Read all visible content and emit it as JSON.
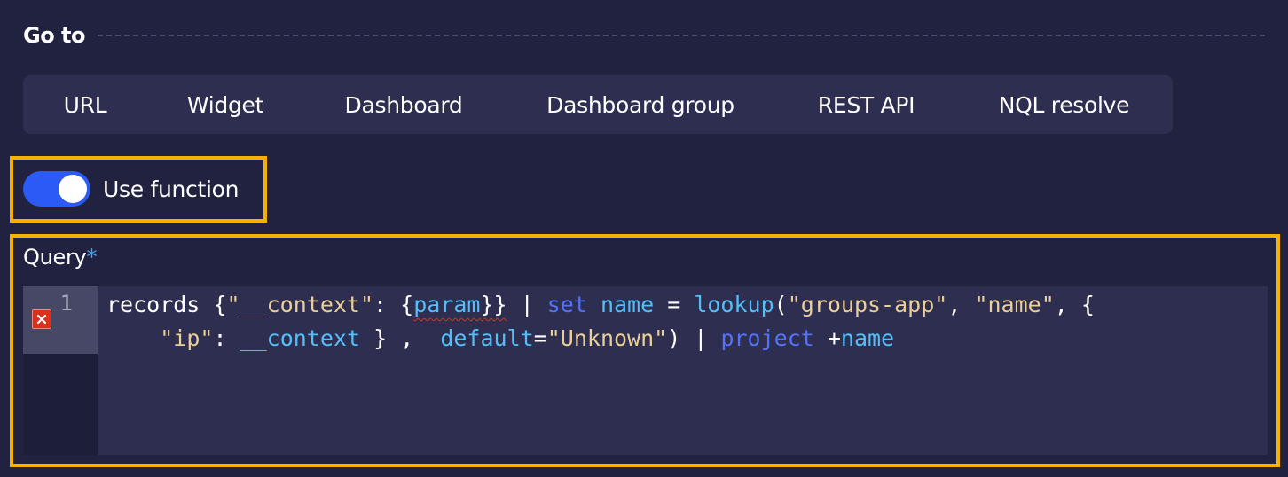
{
  "section": {
    "title": "Go to"
  },
  "tabs": [
    {
      "label": "URL",
      "active": false
    },
    {
      "label": "Widget",
      "active": false
    },
    {
      "label": "Dashboard",
      "active": false
    },
    {
      "label": "Dashboard group",
      "active": false
    },
    {
      "label": "REST API",
      "active": false
    },
    {
      "label": "NQL resolve",
      "active": true
    }
  ],
  "toggle": {
    "label": "Use function",
    "checked": true
  },
  "query": {
    "label": "Query",
    "required_marker": "*",
    "line_number": "1",
    "has_error": true,
    "code_lines": [
      [
        {
          "t": "records {",
          "c": "default"
        },
        {
          "t": "\"__context\"",
          "c": "string"
        },
        {
          "t": ": {",
          "c": "default"
        },
        {
          "t": "param",
          "c": "var",
          "err": true
        },
        {
          "t": "}}",
          "c": "default",
          "err": true
        },
        {
          "t": " | ",
          "c": "default"
        },
        {
          "t": "set",
          "c": "keyword"
        },
        {
          "t": " ",
          "c": "default"
        },
        {
          "t": "name",
          "c": "var"
        },
        {
          "t": " = ",
          "c": "default"
        },
        {
          "t": "lookup",
          "c": "var"
        },
        {
          "t": "(",
          "c": "default"
        },
        {
          "t": "\"groups-app\"",
          "c": "string"
        },
        {
          "t": ", ",
          "c": "default"
        },
        {
          "t": "\"name\"",
          "c": "string"
        },
        {
          "t": ", {",
          "c": "default"
        }
      ],
      [
        {
          "t": "    ",
          "c": "default"
        },
        {
          "t": "\"ip\"",
          "c": "string"
        },
        {
          "t": ": ",
          "c": "default"
        },
        {
          "t": "__context",
          "c": "var"
        },
        {
          "t": " } ,  ",
          "c": "default"
        },
        {
          "t": "default",
          "c": "var"
        },
        {
          "t": "=",
          "c": "default"
        },
        {
          "t": "\"Unknown\"",
          "c": "string"
        },
        {
          "t": ") | ",
          "c": "default"
        },
        {
          "t": "project",
          "c": "keyword"
        },
        {
          "t": " +",
          "c": "default"
        },
        {
          "t": "name",
          "c": "var"
        }
      ]
    ]
  },
  "colors": {
    "background": "#212240",
    "accent": "#2b5bf4",
    "highlight": "#f5b000",
    "error": "#d8311f",
    "string": "#e9cf9a",
    "variable": "#55bef6",
    "keyword": "#5572f5"
  }
}
